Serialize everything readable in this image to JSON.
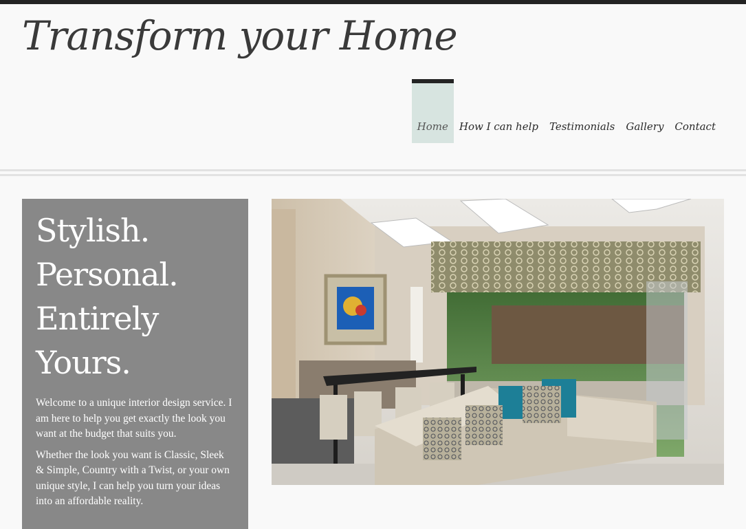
{
  "header": {
    "site_title": "Transform your Home"
  },
  "nav": {
    "items": [
      {
        "label": "Home",
        "active": true
      },
      {
        "label": "How I can help"
      },
      {
        "label": "Testimonials"
      },
      {
        "label": "Gallery"
      },
      {
        "label": "Contact"
      }
    ]
  },
  "intro": {
    "headline": [
      "Stylish.",
      "Personal.",
      "Entirely",
      "Yours."
    ],
    "paragraphs": [
      "Welcome to a unique interior design service. I am here to help you get exactly the look you want at the budget that suits you.",
      "Whether the look you want is Classic, Sleek & Simple, Country with a Twist, or your own unique style, I can help you turn your ideas into an affordable reality."
    ]
  },
  "colors": {
    "top_bar": "#232323",
    "nav_active_bg": "#d7e4e0",
    "panel_bg": "#888888",
    "page_bg": "#f9f9f9"
  }
}
